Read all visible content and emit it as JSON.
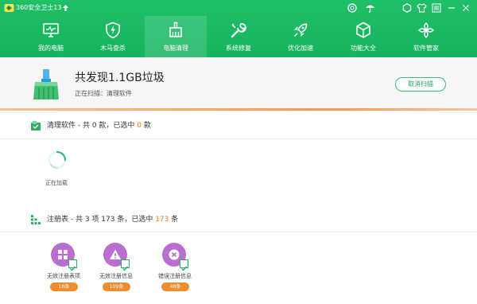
{
  "window": {
    "title": "360安全卫士13",
    "titlebar_icons": [
      "up-arrow-icon",
      "target-icon",
      "umbrella-icon",
      "hexagon-icon",
      "shirt-icon",
      "menu-icon",
      "minimize-icon",
      "close-icon"
    ]
  },
  "nav": {
    "items": [
      {
        "label": "我的电脑",
        "icon": "monitor-icon",
        "active": false
      },
      {
        "label": "木马查杀",
        "icon": "shield-icon",
        "active": false
      },
      {
        "label": "电脑清理",
        "icon": "broom-icon",
        "active": true
      },
      {
        "label": "系统修复",
        "icon": "wrench-icon",
        "active": false
      },
      {
        "label": "优化加速",
        "icon": "rocket-icon",
        "active": false
      },
      {
        "label": "功能大全",
        "icon": "cube-icon",
        "active": false
      },
      {
        "label": "软件管家",
        "icon": "apps-icon",
        "active": false
      }
    ]
  },
  "summary": {
    "title": "共发现1.1GB垃圾",
    "status": "正在扫描：清理软件",
    "cancel_label": "取消扫描"
  },
  "software_section": {
    "label_prefix": "清理软件 - 共 0 款，已选中 ",
    "selected": "0",
    "label_suffix": " 款",
    "loading_text": "正在加载"
  },
  "registry_section": {
    "label_prefix": "注册表 - 共 3 项 173 条，已选中 ",
    "selected": "173",
    "label_suffix": " 条",
    "items": [
      {
        "label": "无效注册表项",
        "badge": "16条",
        "icon": "grid-icon",
        "checked": true
      },
      {
        "label": "无效注册信息",
        "badge": "109条",
        "icon": "warning-icon",
        "checked": true
      },
      {
        "label": "错误注册信息",
        "badge": "48条",
        "icon": "x-circle-icon",
        "checked": true
      }
    ]
  },
  "colors": {
    "brand_green": "#16b35d",
    "accent_orange": "#f07a1e",
    "registry_purple": "#b86fcf"
  }
}
